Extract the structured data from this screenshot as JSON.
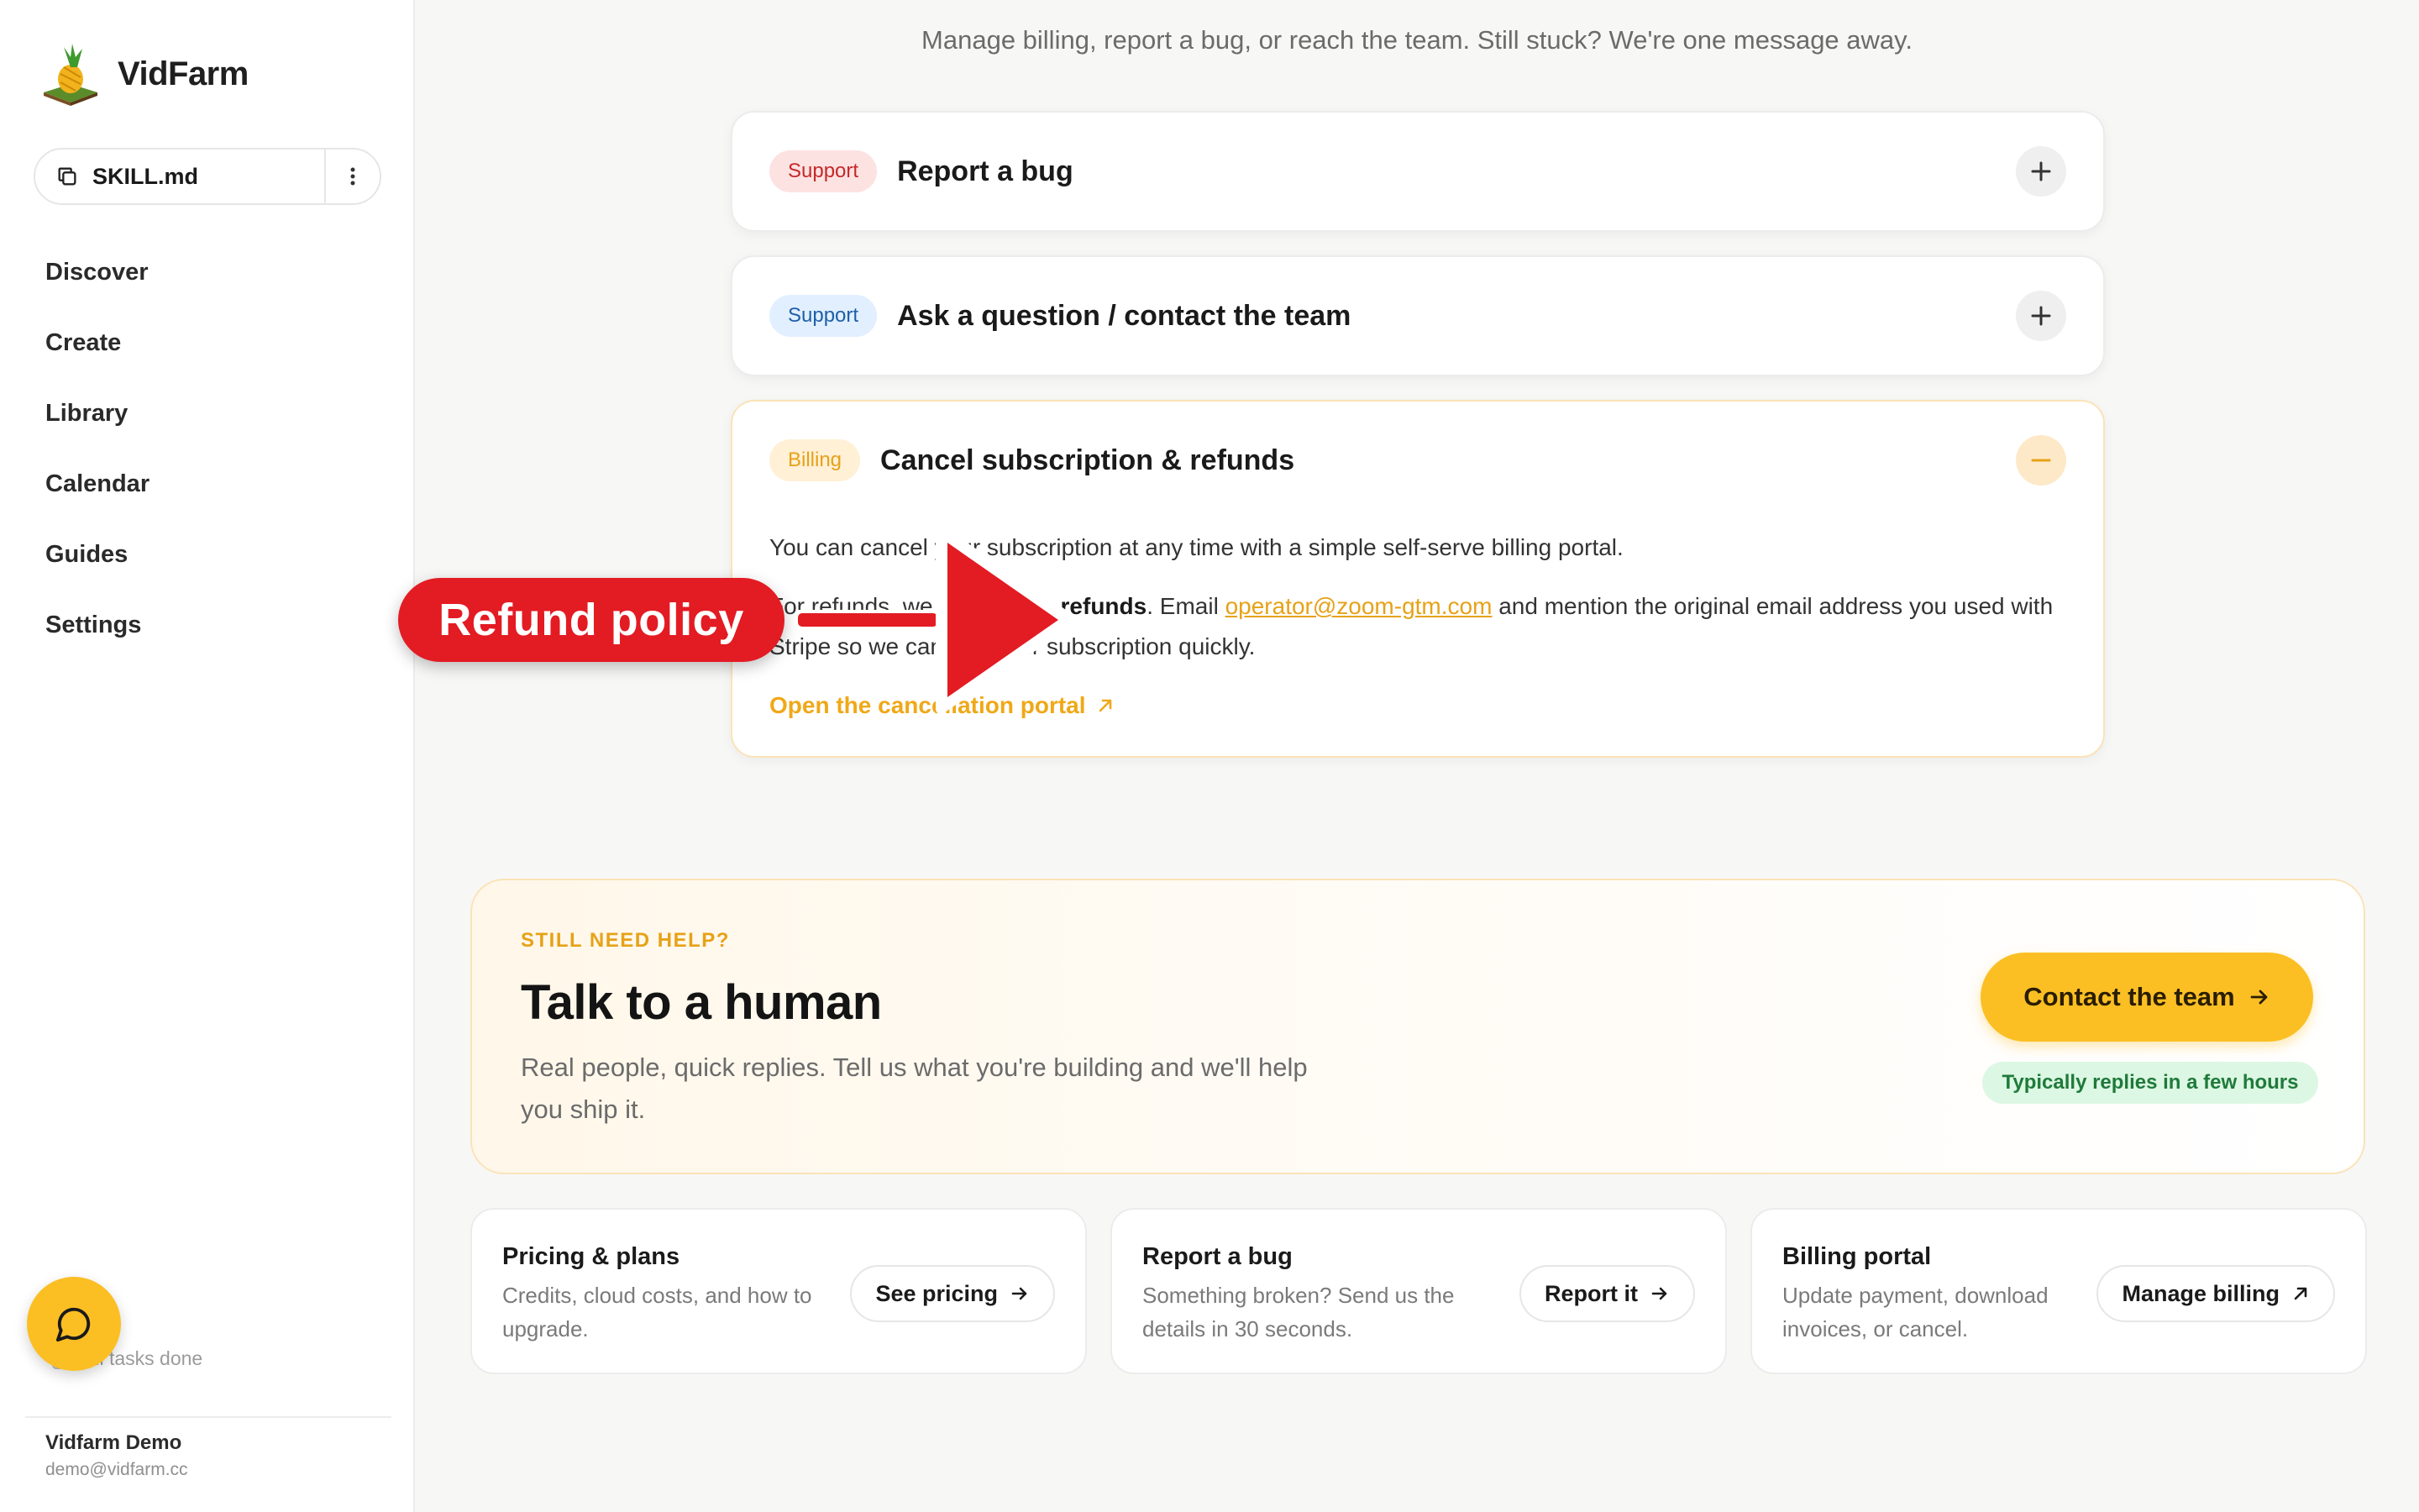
{
  "brand": {
    "name": "VidFarm",
    "logo": "pineapple-logo"
  },
  "file_pill": {
    "name": "SKILL.md",
    "icon": "copy-icon",
    "more_icon": "more-vertical-icon"
  },
  "nav": [
    {
      "label": "Discover"
    },
    {
      "label": "Create"
    },
    {
      "label": "Library"
    },
    {
      "label": "Calendar"
    },
    {
      "label": "Guides"
    },
    {
      "label": "Settings"
    }
  ],
  "tasks_status": "All tasks done",
  "user": {
    "name": "Vidfarm Demo",
    "email": "demo@vidfarm.cc"
  },
  "page": {
    "subtitle": "Manage billing, report a bug, or reach the team. Still stuck? We're one message away."
  },
  "faq": [
    {
      "tag": "Support",
      "title": "Report a bug",
      "state": "collapsed"
    },
    {
      "tag": "Support",
      "title": "Ask a question / contact the team",
      "state": "collapsed"
    },
    {
      "tag": "Billing",
      "title": "Cancel subscription & refunds",
      "state": "expanded",
      "body_p1": "You can cancel your subscription at any time with a simple self-serve billing portal.",
      "body_p2_pre": "For refunds, we offer ",
      "body_p2_strong": "7-day refunds",
      "body_p2_mid": ". Email ",
      "body_p2_email": "operator@zoom-gtm.com",
      "body_p2_post": " and mention the original email address you used with Stripe so we can find your subscription quickly.",
      "link": "Open the cancellation portal"
    }
  ],
  "annotation": {
    "label": "Refund policy",
    "color": "#e31b23"
  },
  "help": {
    "eyebrow": "STILL NEED HELP?",
    "title": "Talk to a human",
    "description": "Real people, quick replies. Tell us what you're building and we'll help you ship it.",
    "button": "Contact the team",
    "badge": "Typically replies in a few hours"
  },
  "cards": [
    {
      "title": "Pricing & plans",
      "description": "Credits, cloud costs, and how to upgrade.",
      "button": "See pricing",
      "icon": "arrow-right-icon"
    },
    {
      "title": "Report a bug",
      "description": "Something broken? Send us the details in 30 seconds.",
      "button": "Report it",
      "icon": "arrow-right-icon"
    },
    {
      "title": "Billing portal",
      "description": "Update payment, download invoices, or cancel.",
      "button": "Manage billing",
      "icon": "external-link-icon"
    }
  ],
  "colors": {
    "accent": "#fbbf24",
    "link": "#e6a217",
    "support_red_bg": "#fde2e2",
    "support_blue_bg": "#e1efff",
    "billing_bg": "#fff0d6",
    "success_bg": "#dcf7e3",
    "success_text": "#1f7a3a"
  }
}
